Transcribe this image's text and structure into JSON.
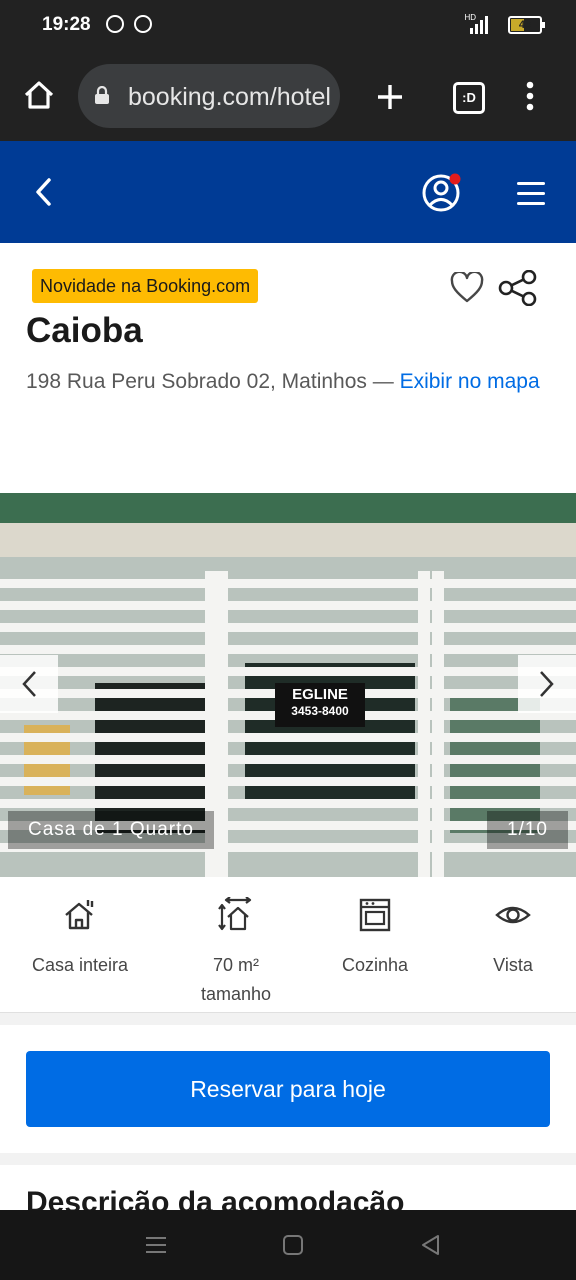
{
  "status_bar": {
    "time": "19:28",
    "battery": "43",
    "network_label": "HD"
  },
  "browser": {
    "url": "booking.com/hotel",
    "tabs_count": ":D"
  },
  "listing": {
    "badge": "Novidade na Booking.com",
    "name": "Caioba",
    "address": "198 Rua Peru Sobrado 02, Matinhos —",
    "map_link": "Exibir no mapa"
  },
  "gallery": {
    "caption": "Casa de 1 Quarto",
    "counter": "1/10",
    "sign_line1": "EGLINE",
    "sign_line2": "3453-8400"
  },
  "facilities": [
    {
      "icon": "house-icon",
      "label": "Casa inteira"
    },
    {
      "icon": "size-icon",
      "label": "70 m² tamanho"
    },
    {
      "icon": "oven-icon",
      "label": "Cozinha"
    },
    {
      "icon": "eye-icon",
      "label": "Vista"
    }
  ],
  "reserve_button": "Reservar para hoje",
  "section_heading": "Descrição da acomodação",
  "colors": {
    "brand_blue": "#003b95",
    "action_blue": "#006ce4",
    "badge_yellow": "#febb02"
  }
}
